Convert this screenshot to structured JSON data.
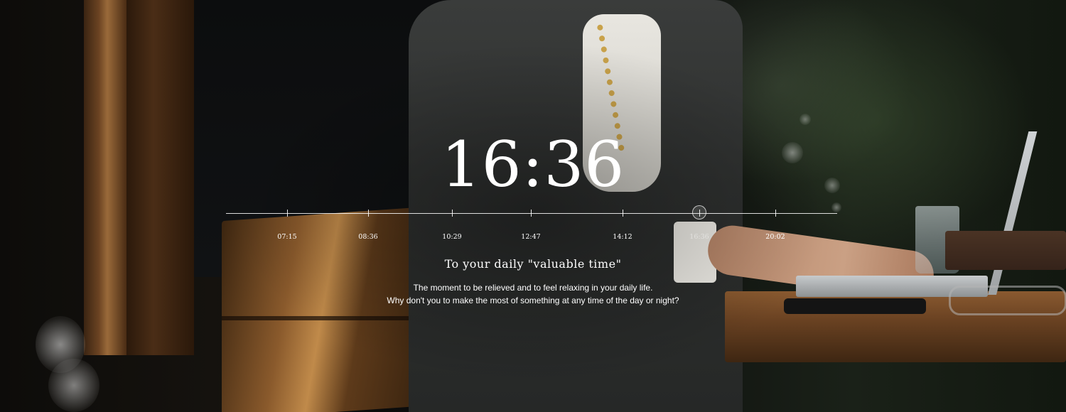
{
  "clock": {
    "time": "16:36"
  },
  "timeline": {
    "marks": [
      {
        "time": "07:15",
        "position": 0.1
      },
      {
        "time": "08:36",
        "position": 0.233
      },
      {
        "time": "10:29",
        "position": 0.37
      },
      {
        "time": "12:47",
        "position": 0.499
      },
      {
        "time": "14:12",
        "position": 0.649
      },
      {
        "time": "16:36",
        "position": 0.774,
        "current": true
      },
      {
        "time": "20:02",
        "position": 0.899
      }
    ]
  },
  "content": {
    "heading": "To your daily \"valuable time\"",
    "description_line1": "The moment to be relieved and to feel relaxing in your daily life.",
    "description_line2": "Why don't you to make the most of something at any time of the day or night?"
  },
  "colors": {
    "text": "#ffffff",
    "line": "#ffffff"
  }
}
